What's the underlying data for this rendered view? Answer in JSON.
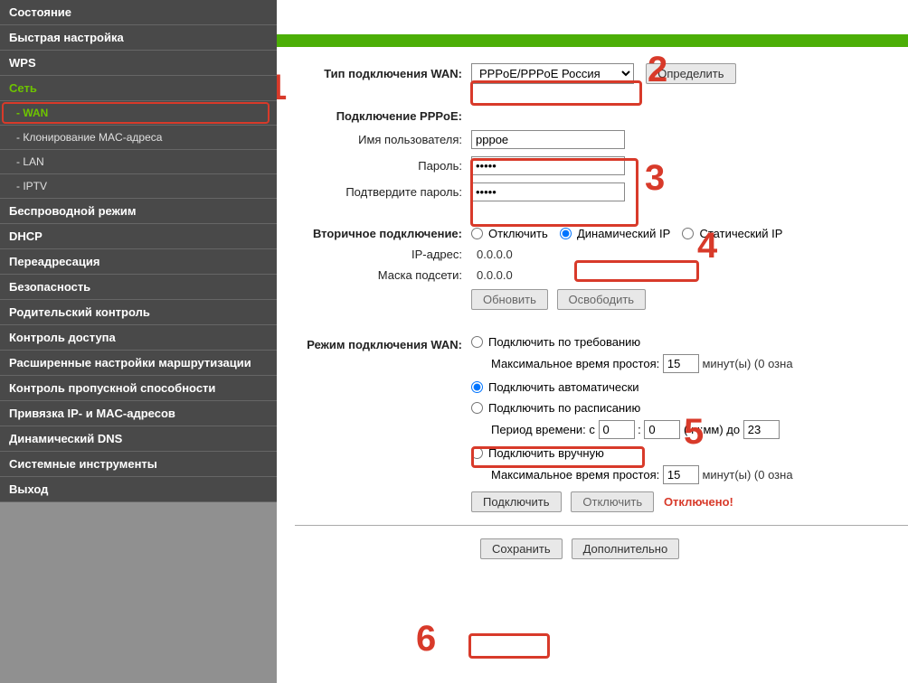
{
  "sidebar": {
    "items": [
      {
        "label": "Состояние"
      },
      {
        "label": "Быстрая настройка"
      },
      {
        "label": "WPS"
      },
      {
        "label": "Сеть",
        "active": true
      },
      {
        "label": "Беспроводной режим"
      },
      {
        "label": "DHCP"
      },
      {
        "label": "Переадресация"
      },
      {
        "label": "Безопасность"
      },
      {
        "label": "Родительский контроль"
      },
      {
        "label": "Контроль доступа"
      },
      {
        "label": "Расширенные настройки маршрутизации"
      },
      {
        "label": "Контроль пропускной способности"
      },
      {
        "label": "Привязка IP- и MAC-адресов"
      },
      {
        "label": "Динамический DNS"
      },
      {
        "label": "Системные инструменты"
      },
      {
        "label": "Выход"
      }
    ],
    "sub_network": [
      {
        "label": "- WAN",
        "active": true
      },
      {
        "label": "- Клонирование MAC-адреса"
      },
      {
        "label": "- LAN"
      },
      {
        "label": "- IPTV"
      }
    ]
  },
  "form": {
    "wan_type_label": "Тип подключения WAN:",
    "wan_type_value": "PPPoE/PPPoE Россия",
    "detect_btn": "Определить",
    "pppoe_header": "Подключение PPPoE:",
    "username_label": "Имя пользователя:",
    "username_value": "pppoe",
    "password_label": "Пароль:",
    "password_value": "•••••",
    "password_confirm_label": "Подтвердите пароль:",
    "password_confirm_value": "•••••",
    "secondary_label": "Вторичное подключение:",
    "sec_opts": {
      "off": "Отключить",
      "dyn": "Динамический IP",
      "static": "Статический IP"
    },
    "ip_label": "IP-адрес:",
    "ip_value": "0.0.0.0",
    "mask_label": "Маска подсети:",
    "mask_value": "0.0.0.0",
    "refresh_btn": "Обновить",
    "release_btn": "Освободить",
    "wan_mode_label": "Режим подключения WAN:",
    "mode_on_demand": "Подключить по требованию",
    "idle_label": "Максимальное время простоя:",
    "idle_value1": "15",
    "minutes_suffix": "минут(ы) (0 озна",
    "mode_auto": "Подключить автоматически",
    "mode_schedule": "Подключить по расписанию",
    "period_label": "Период времени: с",
    "period_from_h": "0",
    "period_from_m": "0",
    "period_hhmm": "(чч:мм) до",
    "period_to_h": "23",
    "mode_manual": "Подключить вручную",
    "idle_value2": "15",
    "connect_btn": "Подключить",
    "disconnect_btn": "Отключить",
    "status_text": "Отключено!",
    "save_btn": "Сохранить",
    "advanced_btn": "Дополнительно"
  },
  "annotations": {
    "n1": "1",
    "n2": "2",
    "n3": "3",
    "n4": "4",
    "n5": "5",
    "n6": "6"
  }
}
